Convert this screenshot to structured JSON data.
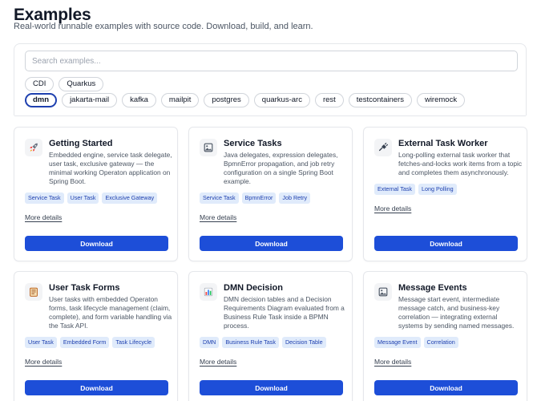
{
  "header": {
    "title": "Examples",
    "subtitle": "Real-world runnable examples with source code. Download, build, and learn."
  },
  "search": {
    "placeholder": "Search examples...",
    "value": ""
  },
  "filters": {
    "row1": [
      "CDI",
      "Quarkus"
    ],
    "row2": [
      "dmn",
      "jakarta-mail",
      "kafka",
      "mailpit",
      "postgres",
      "quarkus-arc",
      "rest",
      "testcontainers",
      "wiremock"
    ],
    "active": "dmn"
  },
  "cards": [
    {
      "icon": "rocket-icon",
      "title": "Getting Started",
      "description": "Embedded engine, service task delegate, user task, exclusive gateway — the minimal working Operaton application on Spring Boot.",
      "tags": [
        "Service Task",
        "User Task",
        "Exclusive Gateway"
      ],
      "more": "More details",
      "download": "Download"
    },
    {
      "icon": "image-icon",
      "title": "Service Tasks",
      "description": "Java delegates, expression delegates, BpmnError propagation, and job retry configuration on a single Spring Boot example.",
      "tags": [
        "Service Task",
        "BpmnError",
        "Job Retry"
      ],
      "more": "More details",
      "download": "Download"
    },
    {
      "icon": "plug-icon",
      "title": "External Task Worker",
      "description": "Long-polling external task worker that fetches-and-locks work items from a topic and completes them asynchronously.",
      "tags": [
        "External Task",
        "Long Polling"
      ],
      "more": "More details",
      "download": "Download"
    },
    {
      "icon": "form-icon",
      "title": "User Task Forms",
      "description": "User tasks with embedded Operaton forms, task lifecycle management (claim, complete), and form variable handling via the Task API.",
      "tags": [
        "User Task",
        "Embedded Form",
        "Task Lifecycle"
      ],
      "more": "More details",
      "download": "Download"
    },
    {
      "icon": "bar-chart-icon",
      "title": "DMN Decision",
      "description": "DMN decision tables and a Decision Requirements Diagram evaluated from a Business Rule Task inside a BPMN process.",
      "tags": [
        "DMN",
        "Business Rule Task",
        "Decision Table"
      ],
      "more": "More details",
      "download": "Download"
    },
    {
      "icon": "image-icon",
      "title": "Message Events",
      "description": "Message start event, intermediate message catch, and business-key correlation — integrating external systems by sending named messages.",
      "tags": [
        "Message Event",
        "Correlation"
      ],
      "more": "More details",
      "download": "Download"
    }
  ],
  "colors": {
    "accent": "#1d4ed8",
    "tag_bg": "#e0ebfb",
    "tag_text": "#1e40af"
  }
}
